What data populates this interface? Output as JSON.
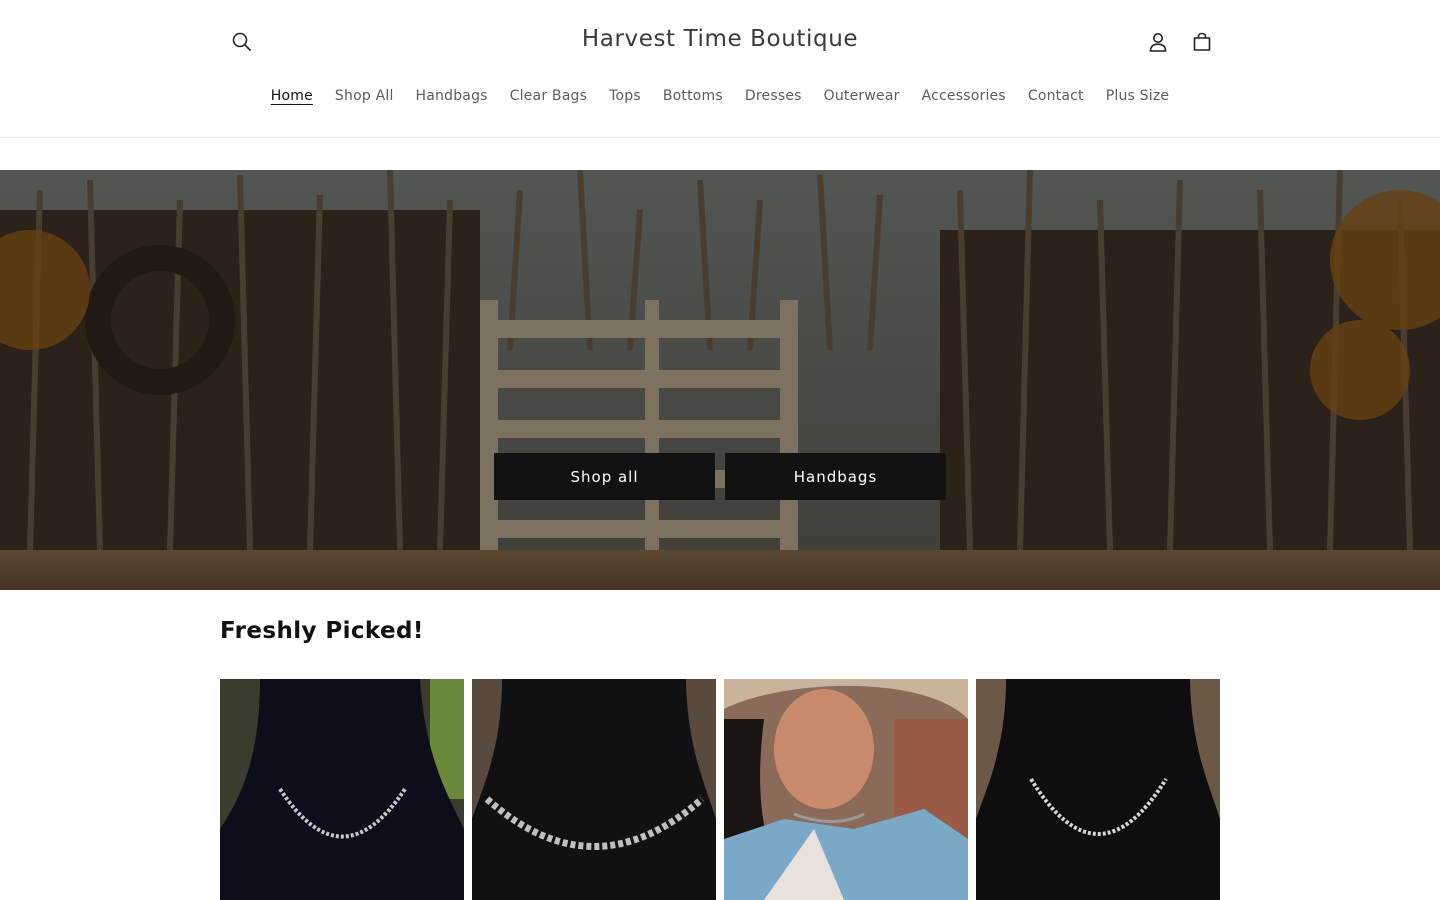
{
  "header": {
    "brand": "Harvest Time Boutique",
    "icons": {
      "search": "search-icon",
      "account": "account-icon",
      "cart": "cart-icon"
    }
  },
  "nav": {
    "items": [
      {
        "label": "Home",
        "active": true
      },
      {
        "label": "Shop All"
      },
      {
        "label": "Handbags"
      },
      {
        "label": "Clear Bags"
      },
      {
        "label": "Tops"
      },
      {
        "label": "Bottoms"
      },
      {
        "label": "Dresses"
      },
      {
        "label": "Outerwear"
      },
      {
        "label": "Accessories"
      },
      {
        "label": "Contact"
      },
      {
        "label": "Plus Size"
      }
    ]
  },
  "hero": {
    "buttons": [
      {
        "label": "Shop all"
      },
      {
        "label": "Handbags"
      }
    ]
  },
  "featured": {
    "title": "Freshly Picked!"
  },
  "colors": {
    "button_bg": "#121212",
    "text": "#121212",
    "nav_text": "#5c5c5c"
  }
}
